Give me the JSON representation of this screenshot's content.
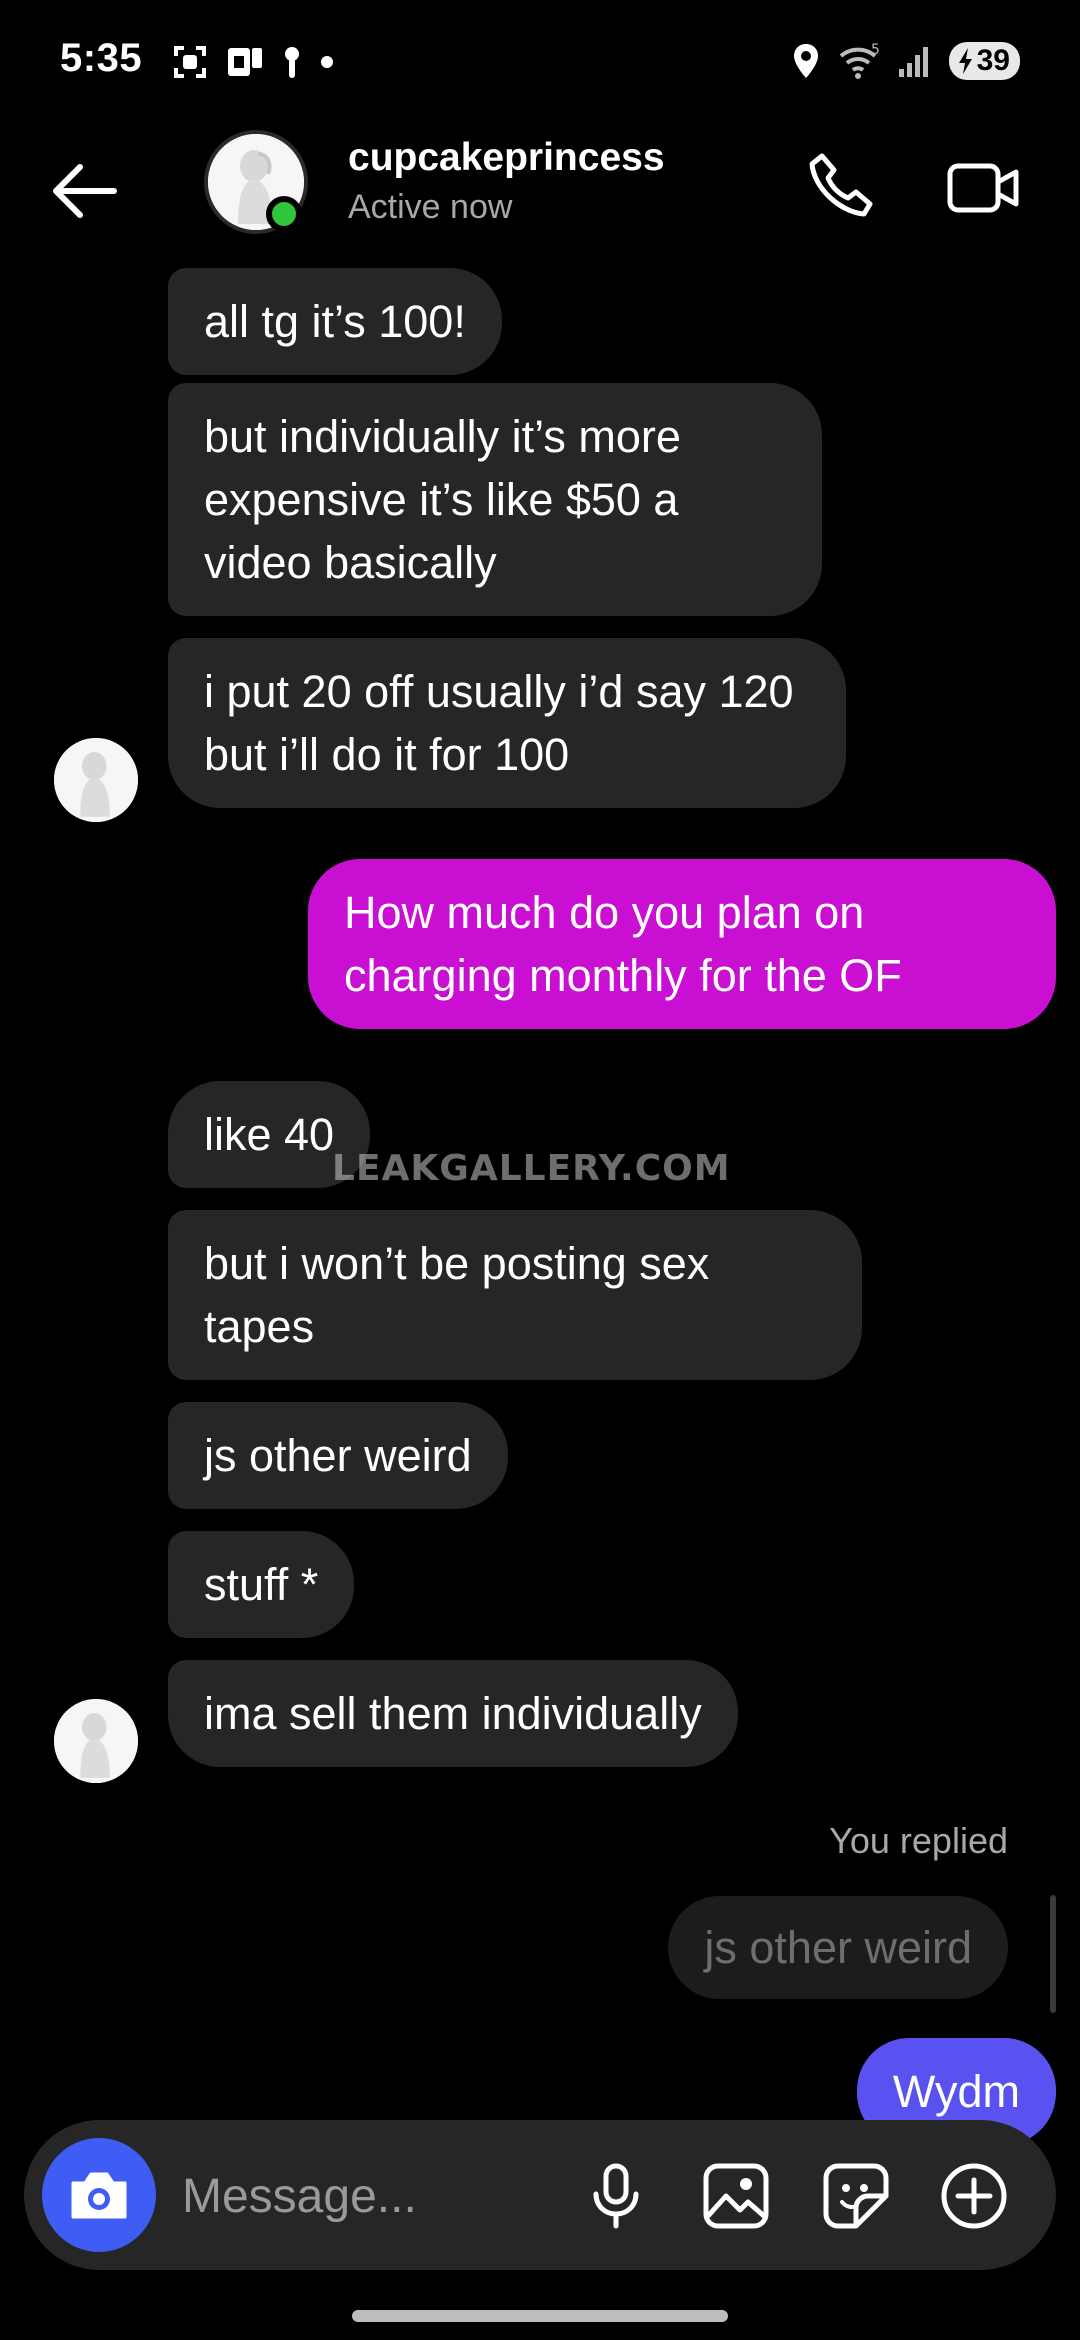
{
  "status_bar": {
    "time": "5:35",
    "battery": "39"
  },
  "header": {
    "contact_name": "cupcakeprincess",
    "contact_status": "Active now"
  },
  "messages": [
    {
      "direction": "in",
      "text": "all tg it’s 100!"
    },
    {
      "direction": "in",
      "text": "but individually it’s more expensive it’s like $50 a video basically"
    },
    {
      "direction": "in",
      "text": "i put 20 off usually i’d say 120 but i’ll do it for 100"
    },
    {
      "direction": "out",
      "text": "How much do you plan on charging monthly for the OF"
    },
    {
      "direction": "in",
      "text": "like 40"
    },
    {
      "direction": "in",
      "text": "but i won’t be posting sex tapes"
    },
    {
      "direction": "in",
      "text": "js other weird"
    },
    {
      "direction": "in",
      "text": "stuff *"
    },
    {
      "direction": "in",
      "text": "ima sell them individually"
    },
    {
      "direction": "out",
      "text": "Wydm"
    }
  ],
  "reply": {
    "label": "You replied",
    "quoted_text": "js other weird"
  },
  "watermark": "LEAKGALLERY.COM",
  "composer": {
    "placeholder": "Message..."
  },
  "colors": {
    "incoming_bubble": "#262626",
    "outgoing_pink": "#c80fd2",
    "outgoing_blue": "#5a52f0",
    "online_green": "#31c43d",
    "camera_blue": "#3f5cf4"
  }
}
